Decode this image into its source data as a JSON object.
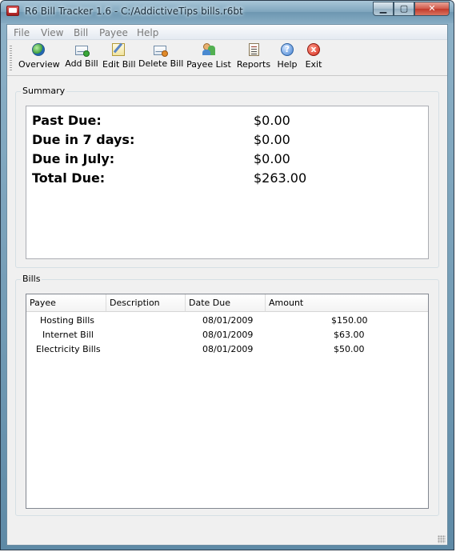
{
  "window": {
    "title": "R6 Bill Tracker 1.6 - C:/AddictiveTips bills.r6bt",
    "minimize": "▁",
    "maximize": "▢",
    "close": "✕"
  },
  "menu": [
    "File",
    "View",
    "Bill",
    "Payee",
    "Help"
  ],
  "toolbar": {
    "overview": "Overview",
    "add_bill": "Add Bill",
    "edit_bill": "Edit Bill",
    "delete_bill": "Delete Bill",
    "payee_list": "Payee List",
    "reports": "Reports",
    "help": "Help",
    "exit": "Exit",
    "help_glyph": "?",
    "exit_glyph": "x"
  },
  "summary": {
    "group_label": "Summary",
    "rows": [
      {
        "label": "Past Due:",
        "value": "$0.00"
      },
      {
        "label": "Due in 7 days:",
        "value": "$0.00"
      },
      {
        "label": "Due in July:",
        "value": "$0.00"
      },
      {
        "label": "Total Due:",
        "value": "$263.00"
      }
    ]
  },
  "bills": {
    "group_label": "Bills",
    "columns": [
      "Payee",
      "Description",
      "Date Due",
      "Amount"
    ],
    "rows": [
      {
        "payee": "Hosting Bills",
        "description": "",
        "date_due": "08/01/2009",
        "amount": "$150.00"
      },
      {
        "payee": "Internet Bill",
        "description": "",
        "date_due": "08/01/2009",
        "amount": "$63.00"
      },
      {
        "payee": "Electricity Bills",
        "description": "",
        "date_due": "08/01/2009",
        "amount": "$50.00"
      }
    ]
  },
  "icons": {
    "app": "bill-tracker-app-icon",
    "overview": "globe-icon",
    "add_bill": "envelope-add-icon",
    "edit_bill": "edit-note-icon",
    "delete_bill": "envelope-delete-icon",
    "payee_list": "people-icon",
    "reports": "report-document-icon",
    "help": "help-icon",
    "exit": "exit-icon"
  }
}
